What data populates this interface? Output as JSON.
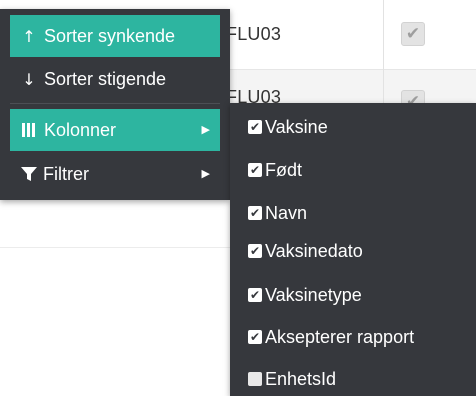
{
  "table": {
    "rows": [
      {
        "text": "FLU03",
        "checked": true
      },
      {
        "text": "FLU03",
        "checked": true
      }
    ]
  },
  "menu": {
    "items": [
      {
        "icon": "arrow-up-icon",
        "glyph": "↑",
        "label": "Sorter synkende"
      },
      {
        "icon": "arrow-down-icon",
        "glyph": "↓",
        "label": "Sorter stigende"
      },
      {
        "icon": "columns-icon",
        "label": "Kolonner",
        "caret": "▶"
      },
      {
        "icon": "filter-icon",
        "label": "Filtrer",
        "caret": "▶"
      }
    ]
  },
  "submenu": {
    "columns": [
      {
        "label": "Vaksine",
        "checked": true
      },
      {
        "label": "Født",
        "checked": true
      },
      {
        "label": "Navn",
        "checked": true
      },
      {
        "label": "Vaksinedato",
        "checked": true
      },
      {
        "label": "Vaksinetype",
        "checked": true
      },
      {
        "label": "Aksepterer rapport",
        "checked": true
      },
      {
        "label": "EnhetsId",
        "checked": false
      }
    ],
    "check_glyph": "✔"
  },
  "colors": {
    "menu_bg": "#36383d",
    "accent": "#2db5a0",
    "text": "#ffffff"
  }
}
